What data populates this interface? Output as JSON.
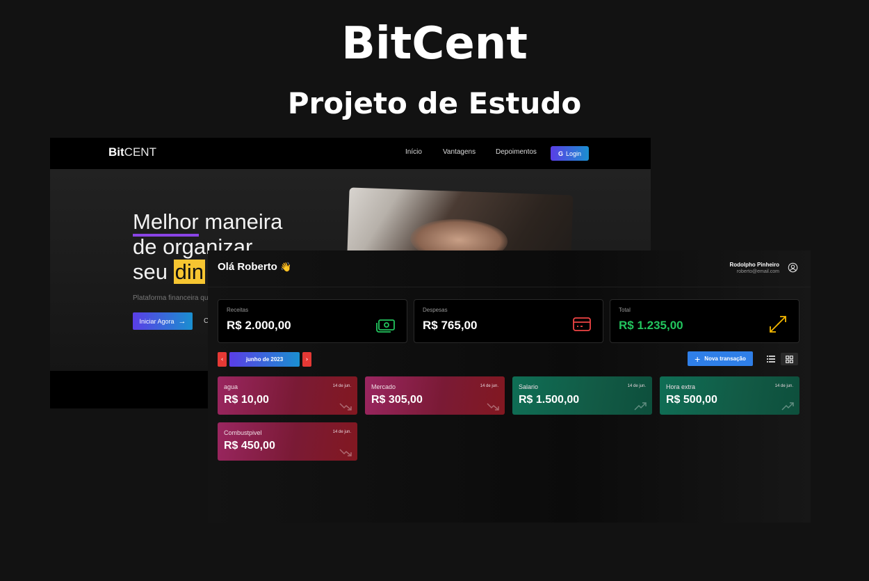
{
  "banner": {
    "title": "BitCent",
    "subtitle": "Projeto de Estudo"
  },
  "landing": {
    "logo_bold": "Bit",
    "logo_light": "CENT",
    "nav": [
      "Início",
      "Vantagens",
      "Depoimentos"
    ],
    "login_label": "Login",
    "login_icon": "google-icon",
    "headline_word1": "Melhor",
    "headline_rest1": " maneira",
    "headline_line2": "de organizar",
    "headline_line3_prefix": "seu ",
    "headline_highlight": "din",
    "description": "Plataforma financeira qu",
    "start_label": "Iniciar Agora",
    "secondary_label": "C",
    "colors": {
      "accent_start": "#5a3ee6",
      "accent_end": "#1a8fd0",
      "highlight": "#f6c531",
      "underline": "#8a44e6"
    }
  },
  "dashboard": {
    "greeting": "Olá Roberto",
    "greeting_emoji": "👋",
    "user_name": "Rodolpho Pinheiro",
    "user_email": "roberto@email.com",
    "summary": [
      {
        "label": "Receitas",
        "value": "R$ 2.000,00",
        "icon": "cash-icon",
        "color": "#22c55e"
      },
      {
        "label": "Despesas",
        "value": "R$ 765,00",
        "icon": "credit-card-icon",
        "color": "#ef4444"
      },
      {
        "label": "Total",
        "value": "R$ 1.235,00",
        "icon": "arrows-diagonal-icon",
        "color": "#f5b800"
      }
    ],
    "month": {
      "prev": "‹",
      "label": "junho de 2023",
      "next": "›"
    },
    "new_transaction_label": "Nova transação",
    "transactions": [
      {
        "description": "agua",
        "date": "14 de jun.",
        "value": "R$ 10,00",
        "type": "expense"
      },
      {
        "description": "Mercado",
        "date": "14 de jun.",
        "value": "R$ 305,00",
        "type": "expense"
      },
      {
        "description": "Salario",
        "date": "14 de jun.",
        "value": "R$ 1.500,00",
        "type": "income"
      },
      {
        "description": "Hora extra",
        "date": "14 de jun.",
        "value": "R$ 500,00",
        "type": "income"
      },
      {
        "description": "Combustpivel",
        "date": "14 de jun.",
        "value": "R$ 450,00",
        "type": "expense"
      }
    ]
  }
}
